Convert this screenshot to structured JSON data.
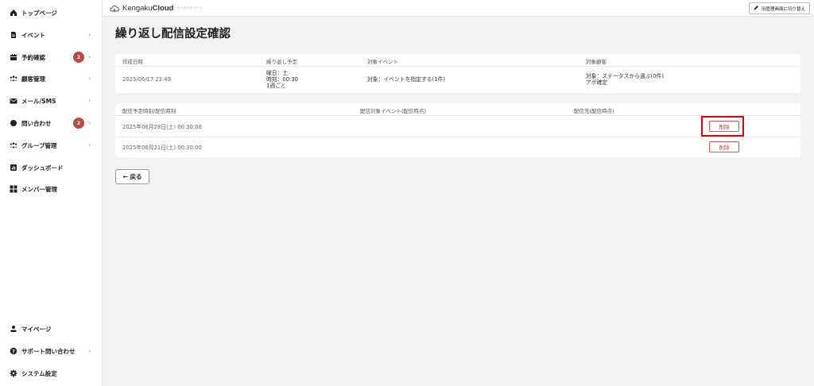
{
  "sidebar": {
    "items": [
      {
        "label": "トップページ",
        "icon": "home-icon"
      },
      {
        "label": "イベント",
        "icon": "document-icon"
      },
      {
        "label": "予約確認",
        "icon": "calendar-icon",
        "badge": "2"
      },
      {
        "label": "顧客管理",
        "icon": "users-icon"
      },
      {
        "label": "メール/SMS",
        "icon": "mail-icon"
      },
      {
        "label": "問い合わせ",
        "icon": "chat-icon",
        "badge": "2"
      },
      {
        "label": "グループ管理",
        "icon": "group-icon"
      },
      {
        "label": "ダッシュボード",
        "icon": "chart-icon"
      },
      {
        "label": "メンバー管理",
        "icon": "grid-icon"
      }
    ],
    "bottom_items": [
      {
        "label": "マイページ",
        "icon": "person-icon"
      },
      {
        "label": "サポート問い合わせ",
        "icon": "help-icon"
      },
      {
        "label": "システム設定",
        "icon": "gear-icon"
      }
    ],
    "chevron": "›"
  },
  "header": {
    "logo_light": "Kengaku",
    "logo_bold": "Cloud",
    "logo_sub": "ケンガククラウド",
    "switch_label": "旧管理画面に切り替え"
  },
  "page": {
    "title": "繰り返し配信設定確認"
  },
  "summary": {
    "headers": [
      "作成日時",
      "繰り返し予定",
      "対象イベント",
      "対象顧客"
    ],
    "created_at": "2025/06/17 23:49",
    "schedule_lines": [
      "曜日：土",
      "時刻：00:30",
      "1週ごと"
    ],
    "target_event": "対象：イベントを指定する(1件)",
    "target_customer_lines": [
      "対象：ステータスから選ぶ(0件)",
      "アポ確定"
    ]
  },
  "deliveries": {
    "headers": [
      "配信予定時刻/配信時刻",
      "配信対象イベント(配信時点)",
      "配信先(配信時点)"
    ],
    "rows": [
      {
        "datetime": "2025年06月28日(土) 00:30:00",
        "delete_label": "削除"
      },
      {
        "datetime": "2025年06月21日(土) 00:30:00",
        "delete_label": "削除"
      }
    ]
  },
  "back_label": "← 戻る",
  "colors": {
    "accent_red": "#c0392b",
    "badge": "#b94a4a",
    "highlight": "#e60000",
    "main_bg": "#f2f2f2"
  }
}
